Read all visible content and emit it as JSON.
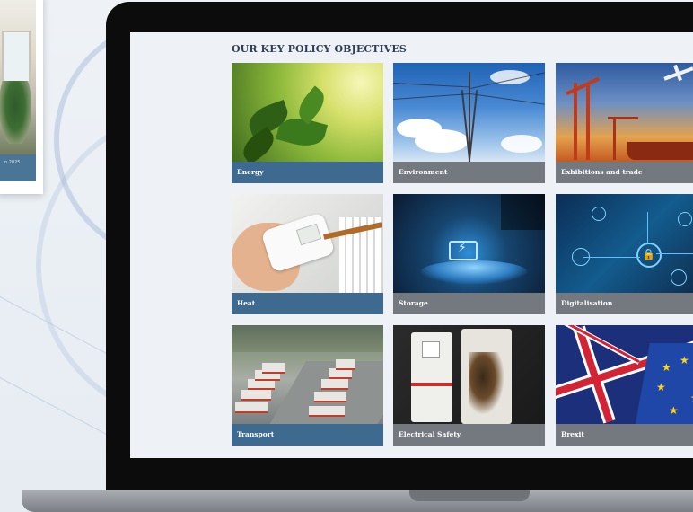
{
  "background_card": {
    "caption": "…n 2025"
  },
  "page": {
    "section_title": "OUR KEY POLICY OBJECTIVES"
  },
  "tiles": [
    {
      "label": "Energy",
      "bar_color": "#3f6a8f"
    },
    {
      "label": "Environment",
      "bar_color": "#74787f"
    },
    {
      "label": "Exhibitions and trade",
      "bar_color": "#74787f"
    },
    {
      "label": "Heat",
      "bar_color": "#3f6a8f"
    },
    {
      "label": "Storage",
      "bar_color": "#74787f"
    },
    {
      "label": "Digitalisation",
      "bar_color": "#74787f"
    },
    {
      "label": "Transport",
      "bar_color": "#3f6a8f"
    },
    {
      "label": "Electrical Safety",
      "bar_color": "#74787f"
    },
    {
      "label": "Brexit",
      "bar_color": "#74787f"
    }
  ]
}
